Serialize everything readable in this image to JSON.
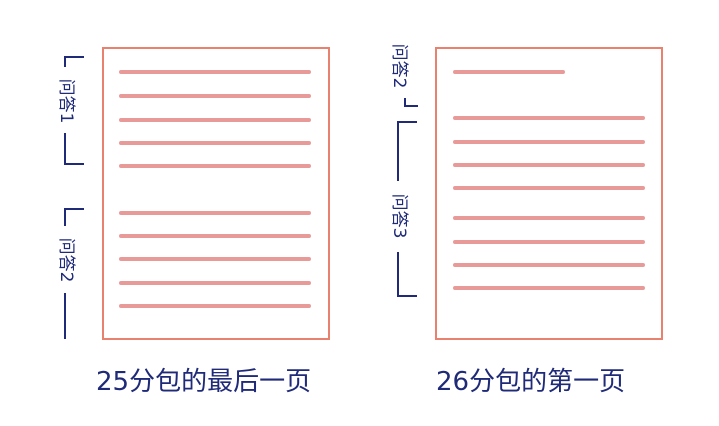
{
  "left_page": {
    "caption": "25分包的最后一页",
    "bracket_top_label": "问答1",
    "bracket_bottom_label": "问答2"
  },
  "right_page": {
    "caption": "26分包的第一页",
    "bracket_top_label": "问答2",
    "bracket_bottom_label": "问答3"
  },
  "colors": {
    "page_border": "#e8826f",
    "text_line": "#e58f8d",
    "bracket": "#1f2a78"
  }
}
